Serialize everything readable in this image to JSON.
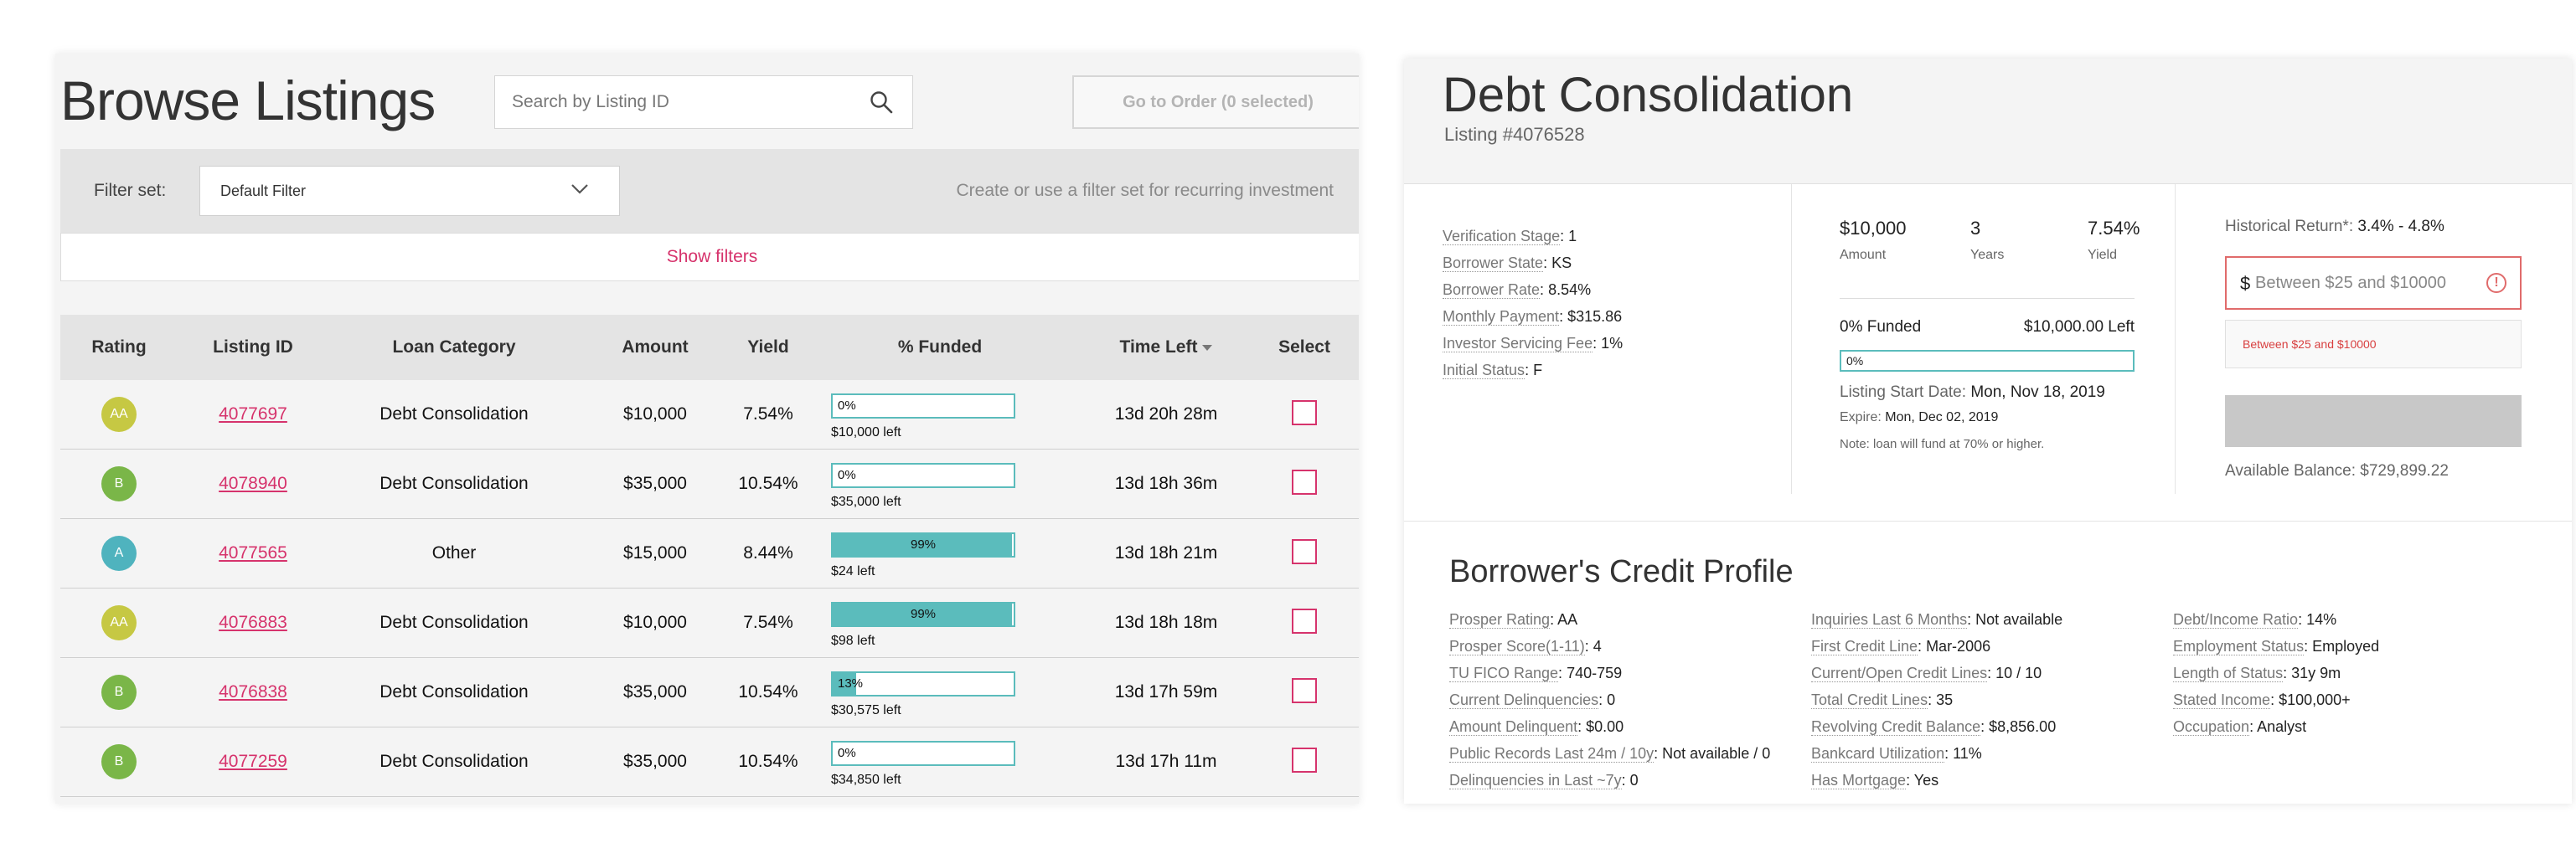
{
  "browse": {
    "title": "Browse Listings",
    "search_placeholder": "Search by Listing ID",
    "order_button": "Go to Order (0 selected)",
    "filter_label": "Filter set:",
    "filter_value": "Default Filter",
    "filter_hint": "Create or use a filter set for recurring investment",
    "show_filters": "Show filters",
    "columns": [
      "Rating",
      "Listing ID",
      "Loan Category",
      "Amount",
      "Yield",
      "% Funded",
      "Time Left",
      "Select"
    ],
    "sorted_column": "Time Left",
    "rows": [
      {
        "rating": "AA",
        "rating_color": "#c6c843",
        "id": "4077697",
        "category": "Debt Consolidation",
        "amount": "$10,000",
        "yield": "7.54%",
        "funded_pct": 0,
        "funded_label": "0%",
        "left": "$10,000 left",
        "time": "13d 20h 28m"
      },
      {
        "rating": "B",
        "rating_color": "#7ab648",
        "id": "4078940",
        "category": "Debt Consolidation",
        "amount": "$35,000",
        "yield": "10.54%",
        "funded_pct": 0,
        "funded_label": "0%",
        "left": "$35,000 left",
        "time": "13d 18h 36m"
      },
      {
        "rating": "A",
        "rating_color": "#4fb3be",
        "id": "4077565",
        "category": "Other",
        "amount": "$15,000",
        "yield": "8.44%",
        "funded_pct": 99,
        "funded_label": "99%",
        "left": "$24 left",
        "time": "13d 18h 21m"
      },
      {
        "rating": "AA",
        "rating_color": "#c6c843",
        "id": "4076883",
        "category": "Debt Consolidation",
        "amount": "$10,000",
        "yield": "7.54%",
        "funded_pct": 99,
        "funded_label": "99%",
        "left": "$98 left",
        "time": "13d 18h 18m"
      },
      {
        "rating": "B",
        "rating_color": "#7ab648",
        "id": "4076838",
        "category": "Debt Consolidation",
        "amount": "$35,000",
        "yield": "10.54%",
        "funded_pct": 13,
        "funded_label": "13%",
        "left": "$30,575 left",
        "time": "13d 17h 59m"
      },
      {
        "rating": "B",
        "rating_color": "#7ab648",
        "id": "4077259",
        "category": "Debt Consolidation",
        "amount": "$35,000",
        "yield": "10.54%",
        "funded_pct": 0,
        "funded_label": "0%",
        "left": "$34,850 left",
        "time": "13d 17h 11m"
      }
    ]
  },
  "detail": {
    "title": "Debt Consolidation",
    "listing_no": "Listing #4076528",
    "info": [
      {
        "k": "Verification Stage",
        "v": "1"
      },
      {
        "k": "Borrower State",
        "v": "KS"
      },
      {
        "k": "Borrower Rate",
        "v": "8.54%"
      },
      {
        "k": "Monthly Payment",
        "v": "$315.86"
      },
      {
        "k": "Investor Servicing Fee",
        "v": "1%"
      },
      {
        "k": "Initial Status",
        "v": "F"
      }
    ],
    "amount": "$10,000",
    "amount_label": "Amount",
    "years": "3",
    "years_label": "Years",
    "yield": "7.54%",
    "yield_label": "Yield",
    "funded_text": "0% Funded",
    "funded_left": "$10,000.00 Left",
    "funded_pct": 0,
    "funded_bar_label": "0%",
    "start_label": "Listing Start Date:",
    "start_value": "Mon, Nov 18, 2019",
    "expire_label": "Expire:",
    "expire_value": "Mon, Dec 02, 2019",
    "note": "Note: loan will fund at 70% or higher.",
    "hist_label": "Historical Return*:",
    "hist_value": "3.4% - 4.8%",
    "currency": "$",
    "amount_placeholder": "Between $25 and $10000",
    "error_text": "Between $25 and $10000",
    "available": "Available Balance: $729,899.22",
    "credit_title": "Borrower's Credit Profile",
    "credit_col1": [
      {
        "k": "Prosper Rating",
        "v": "AA"
      },
      {
        "k": "Prosper Score(1-11)",
        "v": "4"
      },
      {
        "k": "TU FICO Range",
        "v": "740-759"
      },
      {
        "k": "Current Delinquencies",
        "v": "0"
      },
      {
        "k": "Amount Delinquent",
        "v": "$0.00"
      },
      {
        "k": "Public Records Last 24m / 10y",
        "v": "Not available / 0"
      },
      {
        "k": "Delinquencies in Last ~7y",
        "v": "0"
      }
    ],
    "credit_col2": [
      {
        "k": "Inquiries Last 6 Months",
        "v": "Not available"
      },
      {
        "k": "First Credit Line",
        "v": "Mar-2006"
      },
      {
        "k": "Current/Open Credit Lines",
        "v": "10 / 10"
      },
      {
        "k": "Total Credit Lines",
        "v": "35"
      },
      {
        "k": "Revolving Credit Balance",
        "v": "$8,856.00"
      },
      {
        "k": "Bankcard Utilization",
        "v": "11%"
      },
      {
        "k": "Has Mortgage",
        "v": "Yes"
      }
    ],
    "credit_col3": [
      {
        "k": "Debt/Income Ratio",
        "v": "14%"
      },
      {
        "k": "Employment Status",
        "v": "Employed"
      },
      {
        "k": "Length of Status",
        "v": "31y 9m"
      },
      {
        "k": "Stated Income",
        "v": "$100,000+"
      },
      {
        "k": "Occupation",
        "v": "Analyst"
      }
    ]
  }
}
